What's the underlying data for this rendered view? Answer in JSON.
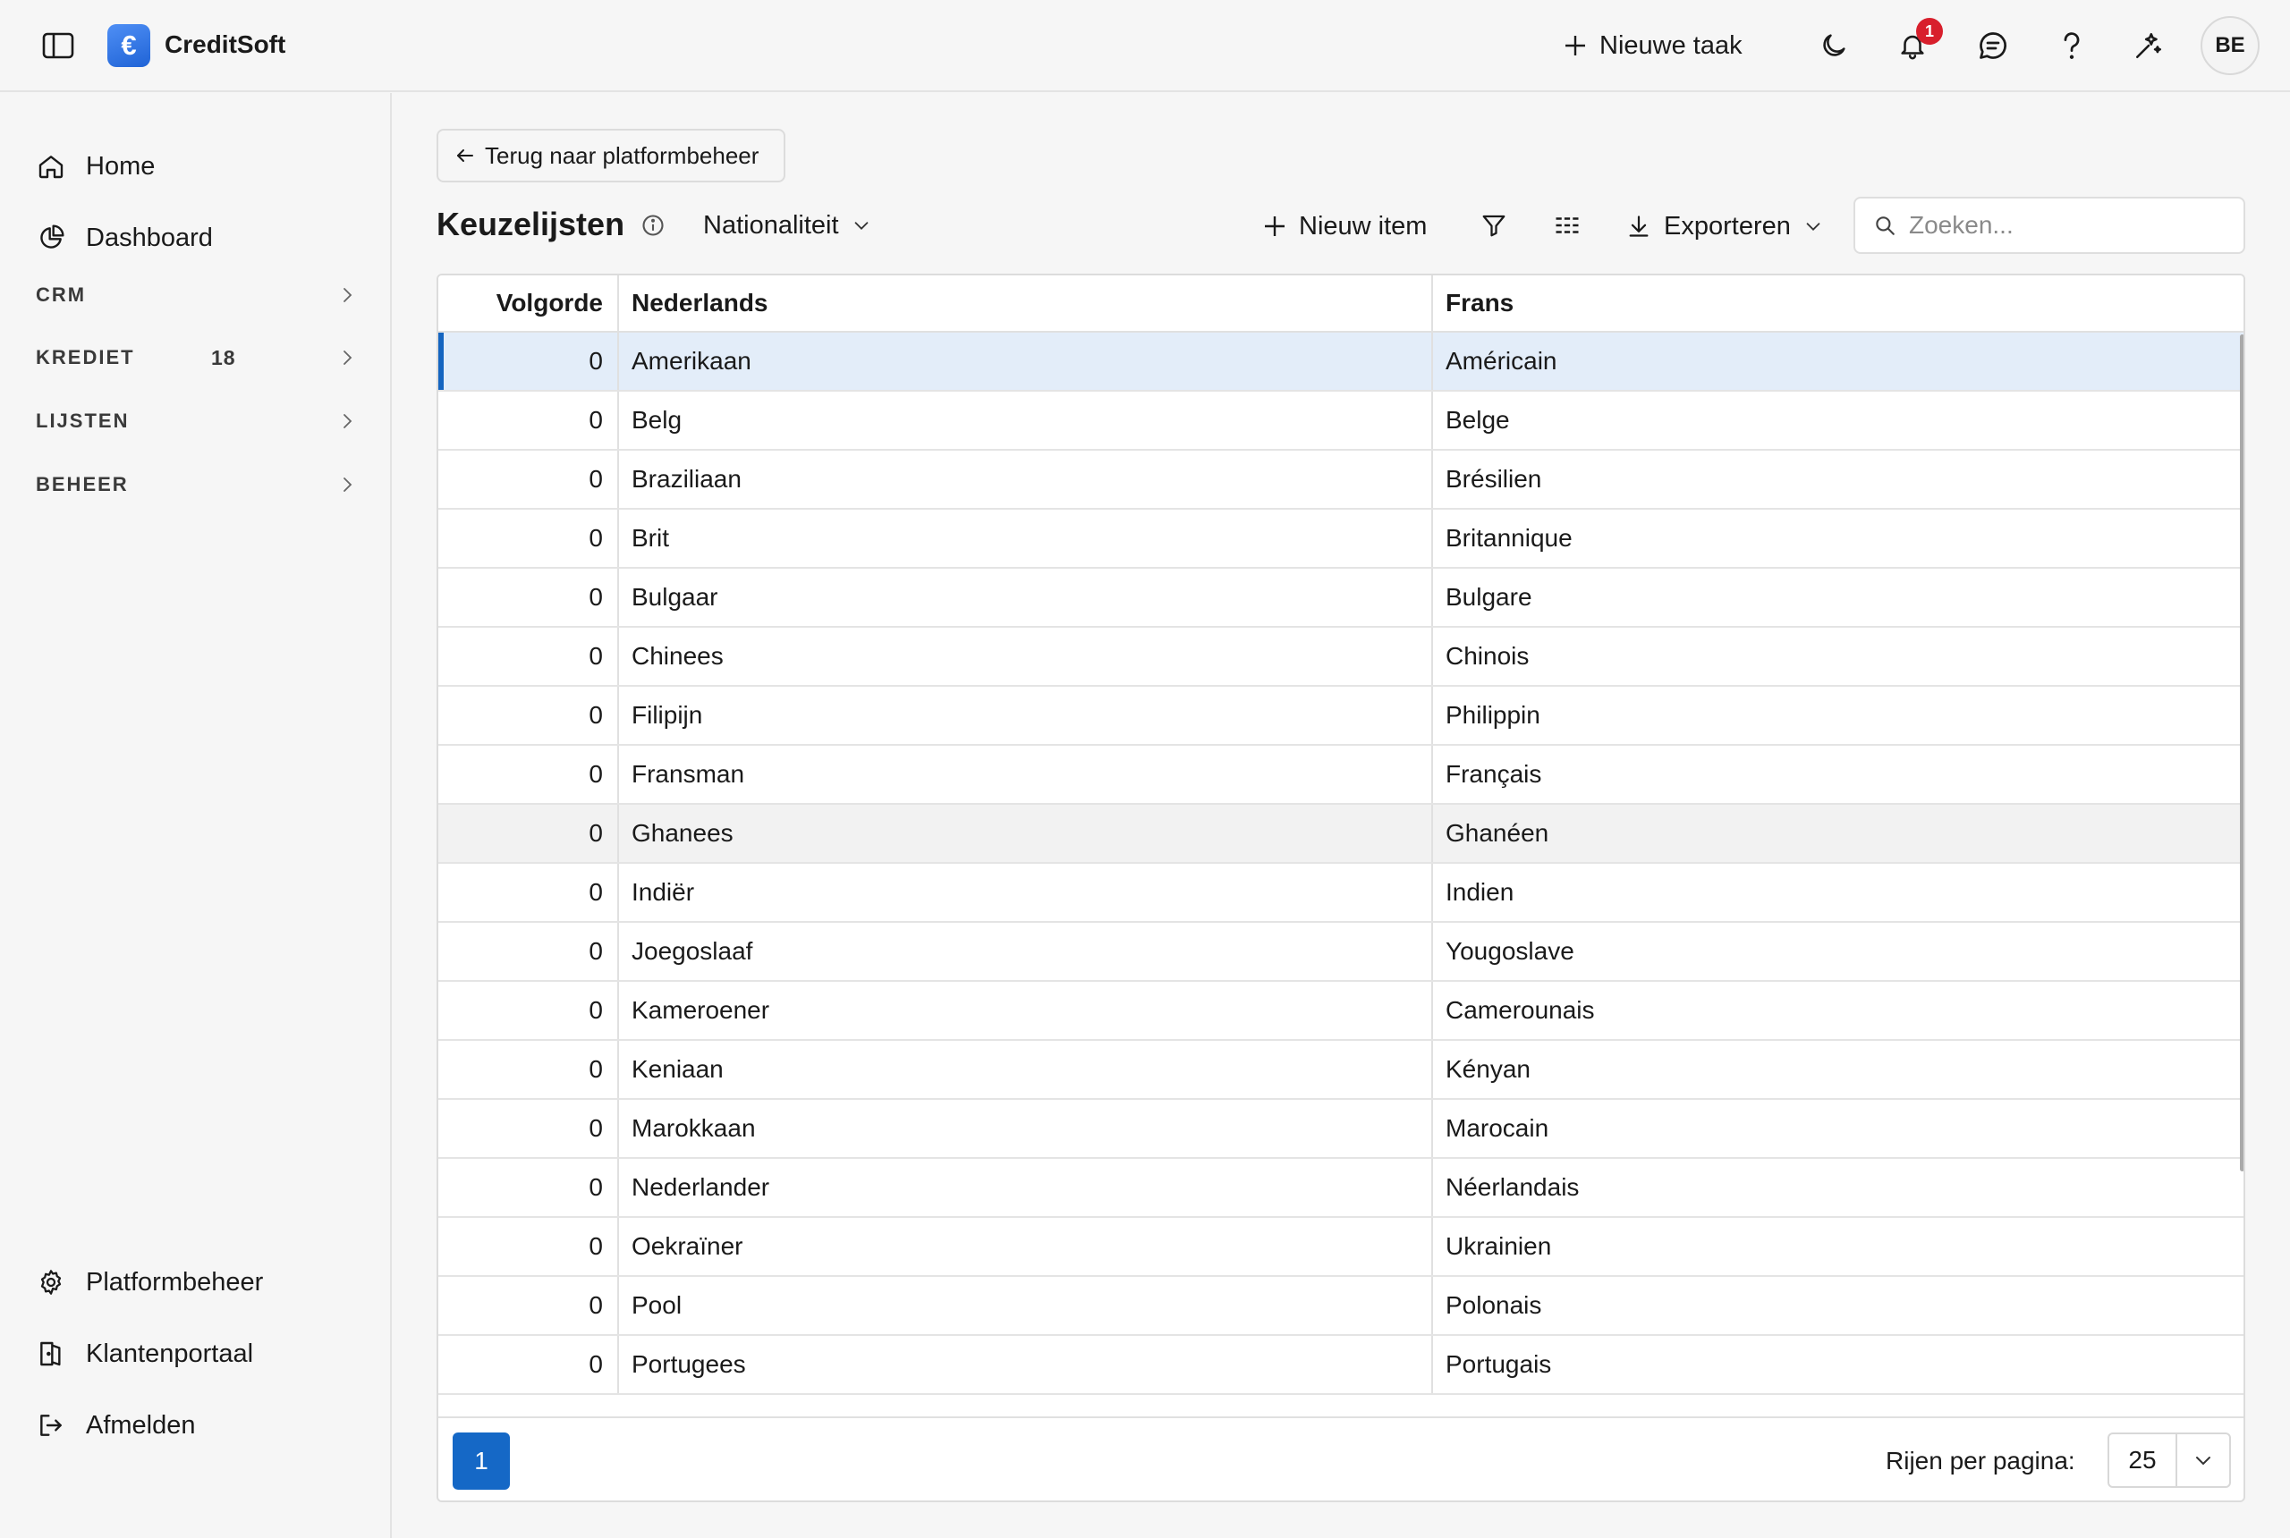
{
  "app": {
    "name": "CreditSoft",
    "logo_symbol": "€",
    "accent_color": "#1568c6",
    "new_task_label": "Nieuwe taak",
    "notification_count": "1",
    "user_initials": "BE"
  },
  "sidebar": {
    "home": "Home",
    "dashboard": "Dashboard",
    "sections": [
      {
        "label": "CRM",
        "count": ""
      },
      {
        "label": "KREDIET",
        "count": "18"
      },
      {
        "label": "LIJSTEN",
        "count": ""
      },
      {
        "label": "BEHEER",
        "count": ""
      }
    ],
    "platform": "Platformbeheer",
    "portal": "Klantenportaal",
    "logout": "Afmelden"
  },
  "main": {
    "back_label": "Terug naar platformbeheer",
    "title": "Keuzelijsten",
    "selected_list": "Nationaliteit",
    "new_item_label": "Nieuw item",
    "export_label": "Exporteren",
    "search_placeholder": "Zoeken..."
  },
  "table": {
    "headers": [
      "Volgorde",
      "Nederlands",
      "Frans"
    ],
    "rows": [
      {
        "order": "0",
        "nl": "Amerikaan",
        "fr": "Américain"
      },
      {
        "order": "0",
        "nl": "Belg",
        "fr": "Belge"
      },
      {
        "order": "0",
        "nl": "Braziliaan",
        "fr": "Brésilien"
      },
      {
        "order": "0",
        "nl": "Brit",
        "fr": "Britannique"
      },
      {
        "order": "0",
        "nl": "Bulgaar",
        "fr": "Bulgare"
      },
      {
        "order": "0",
        "nl": "Chinees",
        "fr": "Chinois"
      },
      {
        "order": "0",
        "nl": "Filipijn",
        "fr": "Philippin"
      },
      {
        "order": "0",
        "nl": "Fransman",
        "fr": "Français"
      },
      {
        "order": "0",
        "nl": "Ghanees",
        "fr": "Ghanéen"
      },
      {
        "order": "0",
        "nl": "Indiër",
        "fr": "Indien"
      },
      {
        "order": "0",
        "nl": "Joegoslaaf",
        "fr": "Yougoslave"
      },
      {
        "order": "0",
        "nl": "Kameroener",
        "fr": "Camerounais"
      },
      {
        "order": "0",
        "nl": "Keniaan",
        "fr": "Kényan"
      },
      {
        "order": "0",
        "nl": "Marokkaan",
        "fr": "Marocain"
      },
      {
        "order": "0",
        "nl": "Nederlander",
        "fr": "Néerlandais"
      },
      {
        "order": "0",
        "nl": "Oekraïner",
        "fr": "Ukrainien"
      },
      {
        "order": "0",
        "nl": "Pool",
        "fr": "Polonais"
      },
      {
        "order": "0",
        "nl": "Portugees",
        "fr": "Portugais"
      }
    ],
    "selected_row_index": 0,
    "hover_row_index": 8
  },
  "pagination": {
    "current_page": "1",
    "rows_per_page_label": "Rijen per pagina:",
    "rows_per_page_value": "25"
  }
}
